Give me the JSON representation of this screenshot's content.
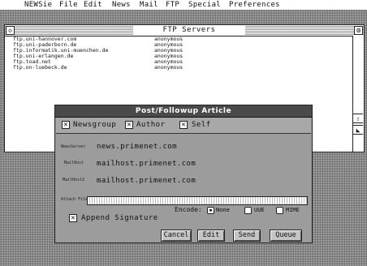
{
  "menubar": {
    "items": [
      "NEWSie",
      "File",
      "Edit",
      "News",
      "Mail",
      "FTP",
      "Special",
      "Preferences"
    ]
  },
  "ftp_window": {
    "title": "FTP Servers",
    "rows": [
      {
        "host": "ftp.uni-hannover.com",
        "user": "anonymous"
      },
      {
        "host": "ftp.uni-paderborn.de",
        "user": "anonymous"
      },
      {
        "host": "ftp.informatik.uni-muenchen.de",
        "user": "anonymous"
      },
      {
        "host": "ftp.uni-erlangen.de",
        "user": "anonymous"
      },
      {
        "host": "ftp.toad.net",
        "user": "anonymous"
      },
      {
        "host": "ftp.on-luebeck.de",
        "user": "anonymous"
      }
    ]
  },
  "dialog": {
    "title": "Post/Followup Article",
    "scope": {
      "newsgroup": {
        "label": "Newsgroup",
        "checked": true
      },
      "author": {
        "label": "Author",
        "checked": true
      },
      "self": {
        "label": "Self",
        "checked": true
      }
    },
    "fields": {
      "news_server_label": "NewsServer",
      "news_server": "news.primenet.com",
      "mail_host_label": "MailHost",
      "mail_host": "mailhost.primenet.com",
      "mail_host_2_label": "MailHost2",
      "mail_host_2": "mailhost.primenet.com",
      "attach_label": "Attach File:",
      "attach_value": ""
    },
    "encode": {
      "label": "Encode:",
      "options": [
        "None",
        "UUE",
        "MIME"
      ],
      "selected": "None"
    },
    "append_signature": {
      "label": "Append Signature",
      "checked": true
    },
    "buttons": {
      "cancel": "Cancel",
      "edit": "Edit",
      "send": "Send",
      "queue": "Queue"
    }
  }
}
